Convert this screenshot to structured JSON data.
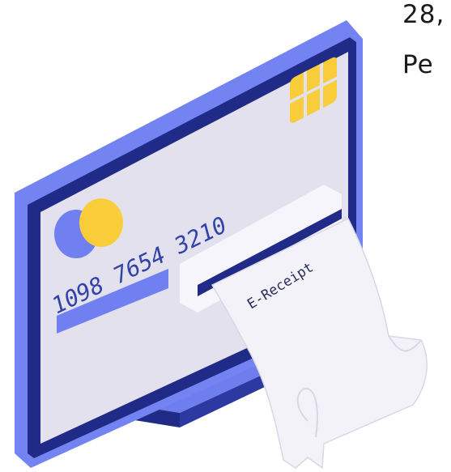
{
  "caption": {
    "line1": "28,",
    "line2": "Pe"
  },
  "card": {
    "number": "1098 7654 3210",
    "receipt_label": "E-Receipt"
  },
  "colors": {
    "screen_frame": "#7483F2",
    "screen_inner_edge": "#1F2B86",
    "card_face": "#E3E1EE",
    "chip": "#F9CD3A",
    "logo_blue": "#7080F0",
    "logo_yellow": "#F9CD3A",
    "stand": "#1F2B86",
    "paper": "#F3F2F8"
  }
}
